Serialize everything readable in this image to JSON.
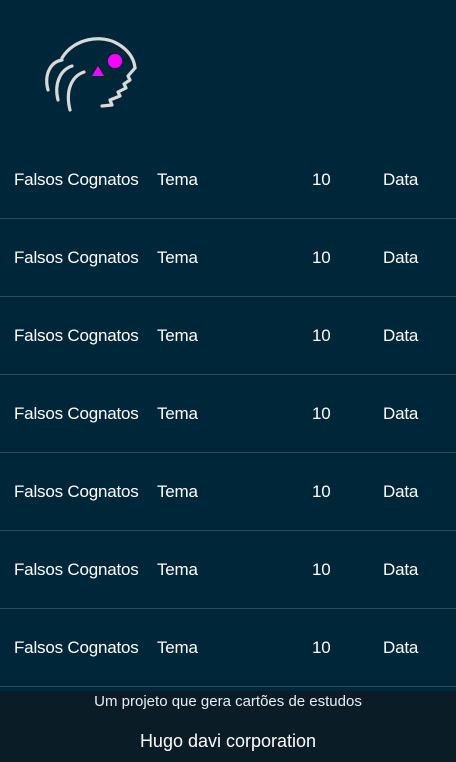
{
  "logo": {
    "icon": "brain-head-icon",
    "colors": {
      "stroke": "#d9d9d9",
      "accent": "#ff00ff"
    }
  },
  "rows": [
    {
      "title": "Falsos Cognatos",
      "tema": "Tema",
      "count": "10",
      "date": "Data"
    },
    {
      "title": "Falsos Cognatos",
      "tema": "Tema",
      "count": "10",
      "date": "Data"
    },
    {
      "title": "Falsos Cognatos",
      "tema": "Tema",
      "count": "10",
      "date": "Data"
    },
    {
      "title": "Falsos Cognatos",
      "tema": "Tema",
      "count": "10",
      "date": "Data"
    },
    {
      "title": "Falsos Cognatos",
      "tema": "Tema",
      "count": "10",
      "date": "Data"
    },
    {
      "title": "Falsos Cognatos",
      "tema": "Tema",
      "count": "10",
      "date": "Data"
    },
    {
      "title": "Falsos Cognatos",
      "tema": "Tema",
      "count": "10",
      "date": "Data"
    }
  ],
  "footer": {
    "tagline": "Um projeto que gera cartões de estudos",
    "company": "Hugo davi corporation"
  },
  "colors": {
    "background": "#00263a",
    "divider": "#2c4b5c",
    "footer_bg": "#0a1c26"
  }
}
